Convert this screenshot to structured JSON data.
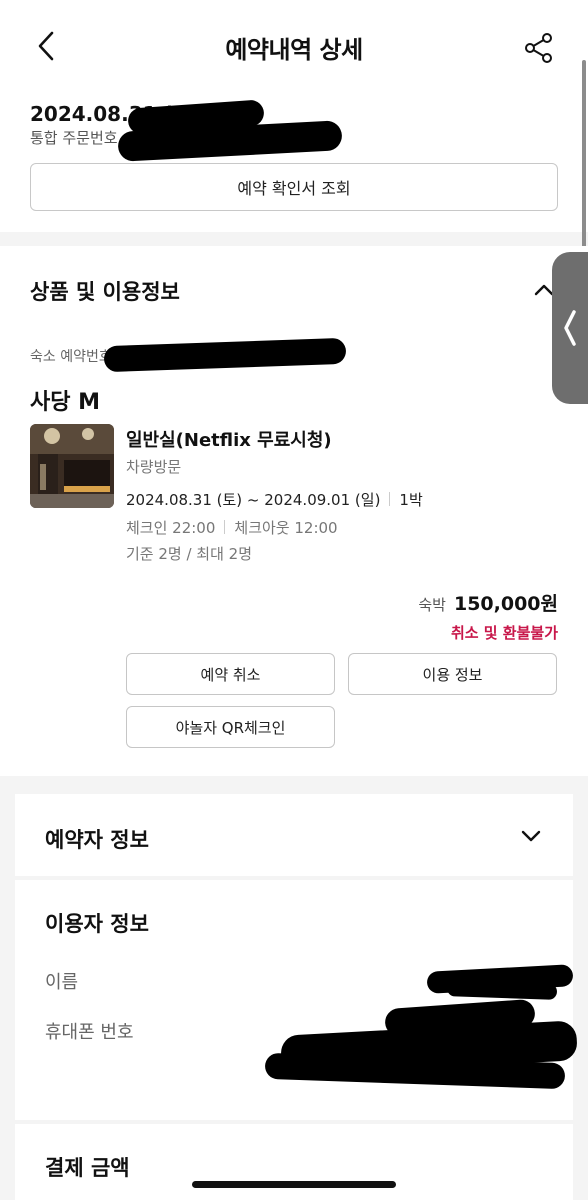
{
  "header": {
    "title": "예약내역 상세",
    "back_icon": "chevron-left-icon",
    "share_icon": "share-icon"
  },
  "order": {
    "date": "2024.08.31 (토)",
    "order_no_label": "통합 주문번호",
    "confirm_button": "예약 확인서 조회"
  },
  "product": {
    "section_title": "상품 및 이용정보",
    "hotel_reservation_label": "숙소 예약번호",
    "hotel_name": "사당 M",
    "room_name": "일반실(Netflix 무료시청)",
    "visit_type": "차량방문",
    "stay_dates": "2024.08.31 (토) ~ 2024.09.01 (일)",
    "nights": "1박",
    "checkin": "체크인 22:00",
    "checkout": "체크아웃 12:00",
    "guests": "기준 2명 / 최대 2명",
    "price_label": "숙박",
    "price_value": "150,000원",
    "refund_note": "취소 및 환불불가",
    "buttons": {
      "cancel": "예약 취소",
      "usage_info": "이용 정보",
      "qr_checkin": "야놀자 QR체크인"
    }
  },
  "booker": {
    "title": "예약자 정보"
  },
  "user_info": {
    "title": "이용자 정보",
    "name_label": "이름",
    "phone_label": "휴대폰 번호"
  },
  "payment": {
    "title": "결제 금액"
  },
  "colors": {
    "accent_red": "#c8174a",
    "border": "#c6c6c6",
    "background": "#f4f4f4"
  }
}
